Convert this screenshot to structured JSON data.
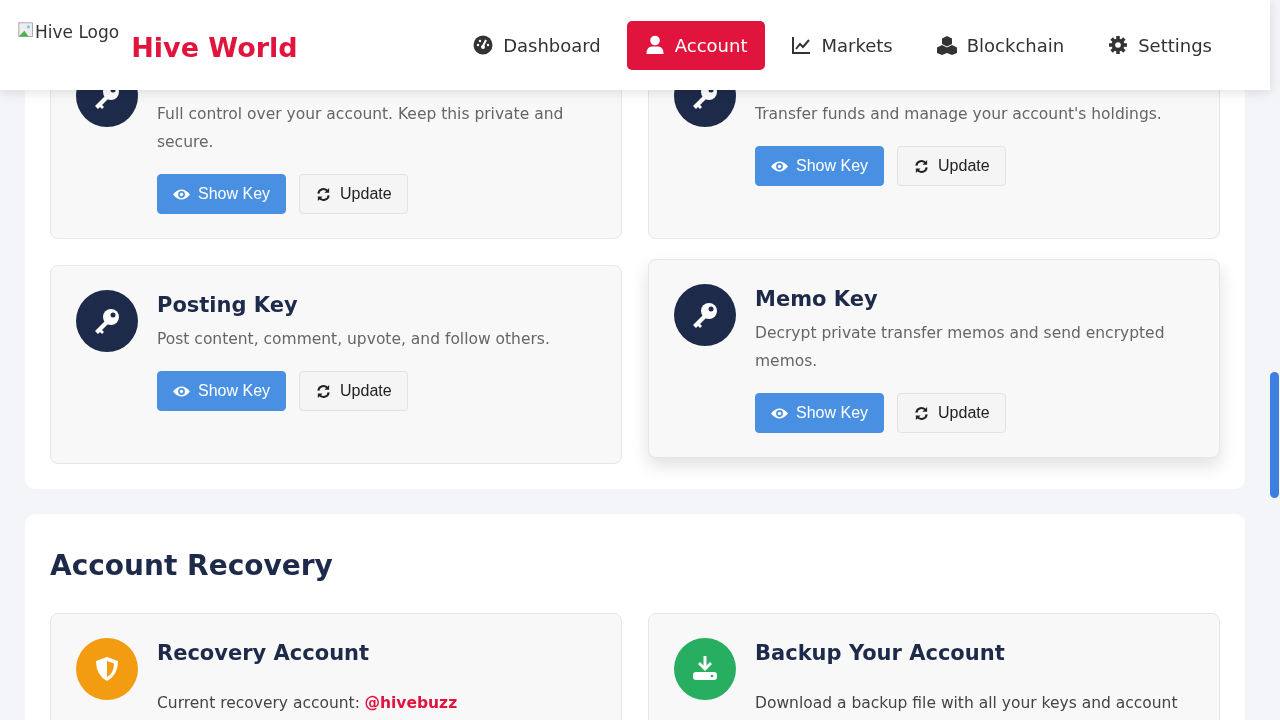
{
  "header": {
    "logo_alt": "Hive Logo",
    "brand": "Hive World",
    "nav": [
      {
        "label": "Dashboard",
        "selected": false
      },
      {
        "label": "Account",
        "selected": true
      },
      {
        "label": "Markets",
        "selected": false
      },
      {
        "label": "Blockchain",
        "selected": false
      },
      {
        "label": "Settings",
        "selected": false
      }
    ]
  },
  "keys": [
    {
      "description": "Full control over your account. Keep this private and secure.",
      "raised": false,
      "buttons": [
        "Show Key",
        "Update"
      ]
    },
    {
      "description": "Transfer funds and manage your account's holdings.",
      "raised": false,
      "buttons": [
        "Show Key",
        "Update"
      ]
    },
    {
      "title": "Posting Key",
      "description": "Post content, comment, upvote, and follow others.",
      "raised": false,
      "buttons": [
        "Show Key",
        "Update"
      ]
    },
    {
      "title": "Memo Key",
      "description": "Decrypt private transfer memos and send encrypted memos.",
      "raised": true,
      "buttons": [
        "Show Key",
        "Update"
      ]
    }
  ],
  "recovery": {
    "heading": "Account Recovery",
    "cards": [
      {
        "color": "#f39c12",
        "title": "Recovery Account",
        "text": "Current recovery account:",
        "account": "@hivebuzz"
      },
      {
        "color": "#27ae60",
        "title": "Backup Your Account",
        "text": "Download a backup file with all your keys and account"
      }
    ]
  }
}
